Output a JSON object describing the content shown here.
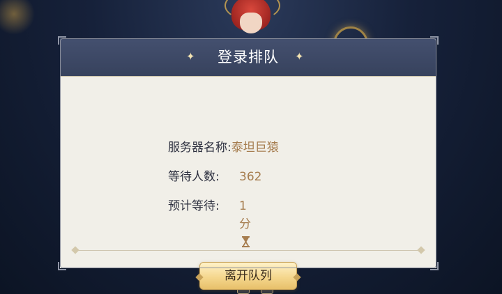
{
  "dialog": {
    "title": "登录排队",
    "title_sparkle": "✦",
    "rows": [
      {
        "label": "服务器名称:",
        "value": "泰坦巨猿"
      },
      {
        "label": "等待人数:",
        "value": "362"
      },
      {
        "label": "预计等待:",
        "value": "1分"
      }
    ],
    "leave_button": "离开队列",
    "wait_icon": "hourglass-icon"
  },
  "colors": {
    "header_bg": "#3b4662",
    "panel_bg": "#f1efe8",
    "value_text": "#a67d4f",
    "button_gold": "#f5d78e"
  }
}
